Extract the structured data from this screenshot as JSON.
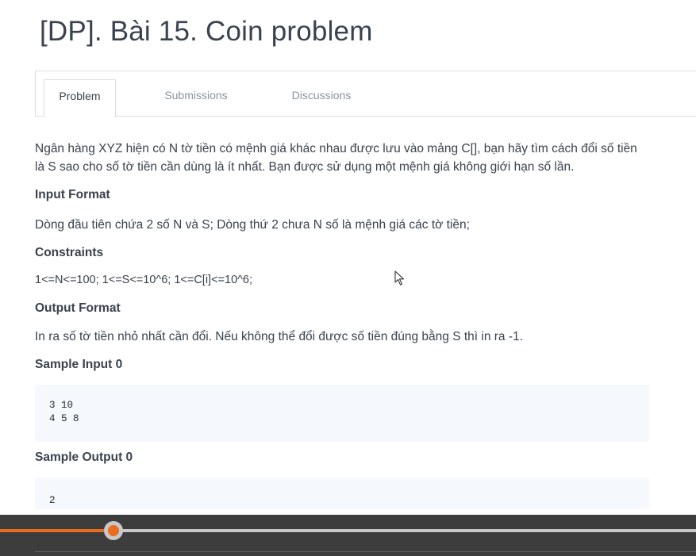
{
  "page": {
    "title": "[DP]. Bài 15. Coin problem"
  },
  "tabs": [
    {
      "label": "Problem",
      "active": true
    },
    {
      "label": "Submissions",
      "active": false
    },
    {
      "label": "Discussions",
      "active": false
    }
  ],
  "problem": {
    "statement_line1": "Ngân hàng XYZ hiện có N tờ tiền có mệnh giá khác nhau được lưu vào mảng C[], bạn hãy tìm cách đổi số tiền",
    "statement_line2": "là S sao cho số tờ tiền cần dùng là ít nhất. Bạn được sử dụng một mệnh giá không giới hạn số lần.",
    "input_format_heading": "Input Format",
    "input_format": "Dòng đầu tiên chứa 2 số N và S; Dòng thứ 2 chưa N số là mệnh giá các tờ tiền;",
    "constraints_heading": "Constraints",
    "constraints": "1<=N<=100; 1<=S<=10^6; 1<=C[i]<=10^6;",
    "output_format_heading": "Output Format",
    "output_format": "In ra số tờ tiền nhỏ nhất cần đổi. Nếu không thể đổi được số tiền đúng bằng S thì in ra -1.",
    "sample_input_heading": "Sample Input 0",
    "sample_input_line1": "3 10",
    "sample_input_line2": "4 5 8",
    "sample_output_heading": "Sample Output 0",
    "sample_output": "2"
  },
  "video_player": {
    "progress": 0.163,
    "accent_color": "#ea6c1f",
    "track_color": "#c8c8c8",
    "bar_color": "#3d3d3d"
  },
  "icons": {
    "mouse_cursor": "mouse-pointer-icon"
  }
}
